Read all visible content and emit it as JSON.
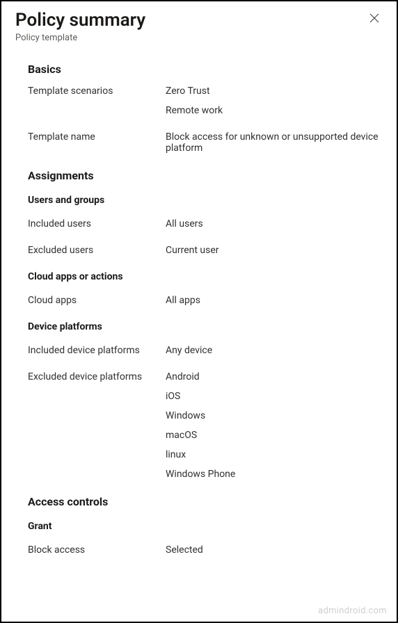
{
  "header": {
    "title": "Policy summary",
    "subtitle": "Policy template"
  },
  "sections": {
    "basics": {
      "heading": "Basics",
      "template_scenarios_label": "Template scenarios",
      "template_scenarios_values": [
        "Zero Trust",
        "Remote work"
      ],
      "template_name_label": "Template name",
      "template_name_value": "Block access for unknown or unsupported device platform"
    },
    "assignments": {
      "heading": "Assignments",
      "users_groups": {
        "heading": "Users and groups",
        "included_users_label": "Included users",
        "included_users_value": "All users",
        "excluded_users_label": "Excluded users",
        "excluded_users_value": "Current user"
      },
      "cloud_apps": {
        "heading": "Cloud apps or actions",
        "cloud_apps_label": "Cloud apps",
        "cloud_apps_value": "All apps"
      },
      "device_platforms": {
        "heading": "Device platforms",
        "included_label": "Included device platforms",
        "included_value": "Any device",
        "excluded_label": "Excluded device platforms",
        "excluded_values": [
          "Android",
          "iOS",
          "Windows",
          "macOS",
          "linux",
          "Windows Phone"
        ]
      }
    },
    "access_controls": {
      "heading": "Access controls",
      "grant": {
        "heading": "Grant",
        "block_access_label": "Block access",
        "block_access_value": "Selected"
      }
    }
  },
  "watermark": "admindroid.com"
}
